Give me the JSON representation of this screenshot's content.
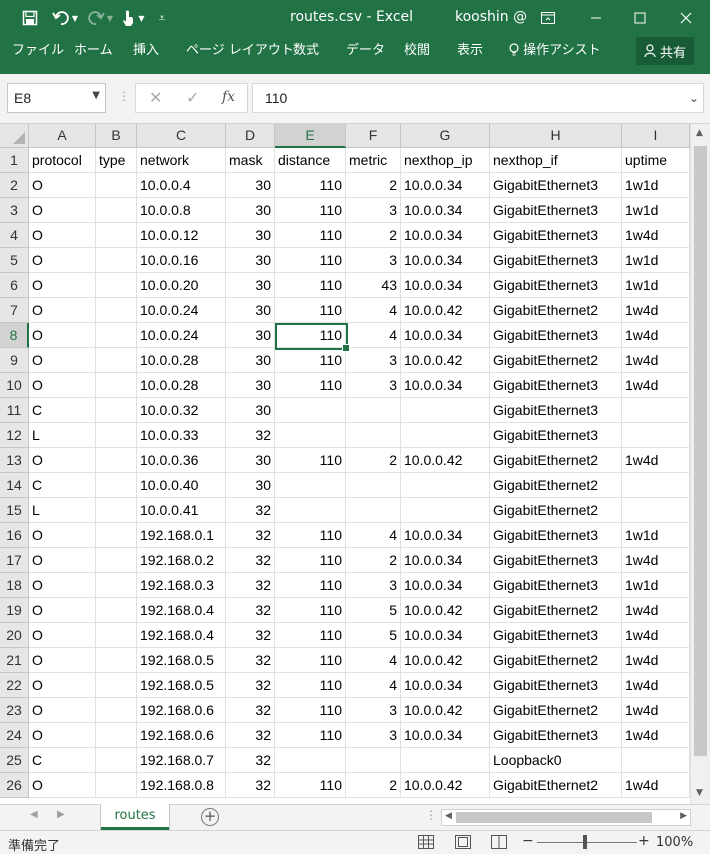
{
  "window": {
    "doc_title": "routes.csv  -  Excel",
    "user": "kooshin @",
    "share_label": "共有"
  },
  "ribbon": {
    "tabs": [
      "ファイル",
      "ホーム",
      "挿入",
      "ページ レイアウト",
      "数式",
      "データ",
      "校閲",
      "表示",
      "操作アシスト"
    ]
  },
  "formula_bar": {
    "name_box": "E8",
    "content": "110"
  },
  "columns": [
    "A",
    "B",
    "C",
    "D",
    "E",
    "F",
    "G",
    "H",
    "I"
  ],
  "selected_column": "E",
  "selected_row": 8,
  "rows": [
    {
      "n": 1,
      "cells": [
        "protocol",
        "type",
        "network",
        "mask",
        "distance",
        "metric",
        "nexthop_ip",
        "nexthop_if",
        "uptime"
      ]
    },
    {
      "n": 2,
      "cells": [
        "O",
        "",
        "10.0.0.4",
        "30",
        "110",
        "2",
        "10.0.0.34",
        "GigabitEthernet3",
        "1w1d"
      ]
    },
    {
      "n": 3,
      "cells": [
        "O",
        "",
        "10.0.0.8",
        "30",
        "110",
        "3",
        "10.0.0.34",
        "GigabitEthernet3",
        "1w1d"
      ]
    },
    {
      "n": 4,
      "cells": [
        "O",
        "",
        "10.0.0.12",
        "30",
        "110",
        "2",
        "10.0.0.34",
        "GigabitEthernet3",
        "1w4d"
      ]
    },
    {
      "n": 5,
      "cells": [
        "O",
        "",
        "10.0.0.16",
        "30",
        "110",
        "3",
        "10.0.0.34",
        "GigabitEthernet3",
        "1w1d"
      ]
    },
    {
      "n": 6,
      "cells": [
        "O",
        "",
        "10.0.0.20",
        "30",
        "110",
        "43",
        "10.0.0.34",
        "GigabitEthernet3",
        "1w1d"
      ]
    },
    {
      "n": 7,
      "cells": [
        "O",
        "",
        "10.0.0.24",
        "30",
        "110",
        "4",
        "10.0.0.42",
        "GigabitEthernet2",
        "1w4d"
      ]
    },
    {
      "n": 8,
      "cells": [
        "O",
        "",
        "10.0.0.24",
        "30",
        "110",
        "4",
        "10.0.0.34",
        "GigabitEthernet3",
        "1w4d"
      ]
    },
    {
      "n": 9,
      "cells": [
        "O",
        "",
        "10.0.0.28",
        "30",
        "110",
        "3",
        "10.0.0.42",
        "GigabitEthernet2",
        "1w4d"
      ]
    },
    {
      "n": 10,
      "cells": [
        "O",
        "",
        "10.0.0.28",
        "30",
        "110",
        "3",
        "10.0.0.34",
        "GigabitEthernet3",
        "1w4d"
      ]
    },
    {
      "n": 11,
      "cells": [
        "C",
        "",
        "10.0.0.32",
        "30",
        "",
        "",
        "",
        "GigabitEthernet3",
        ""
      ]
    },
    {
      "n": 12,
      "cells": [
        "L",
        "",
        "10.0.0.33",
        "32",
        "",
        "",
        "",
        "GigabitEthernet3",
        ""
      ]
    },
    {
      "n": 13,
      "cells": [
        "O",
        "",
        "10.0.0.36",
        "30",
        "110",
        "2",
        "10.0.0.42",
        "GigabitEthernet2",
        "1w4d"
      ]
    },
    {
      "n": 14,
      "cells": [
        "C",
        "",
        "10.0.0.40",
        "30",
        "",
        "",
        "",
        "GigabitEthernet2",
        ""
      ]
    },
    {
      "n": 15,
      "cells": [
        "L",
        "",
        "10.0.0.41",
        "32",
        "",
        "",
        "",
        "GigabitEthernet2",
        ""
      ]
    },
    {
      "n": 16,
      "cells": [
        "O",
        "",
        "192.168.0.1",
        "32",
        "110",
        "4",
        "10.0.0.34",
        "GigabitEthernet3",
        "1w1d"
      ]
    },
    {
      "n": 17,
      "cells": [
        "O",
        "",
        "192.168.0.2",
        "32",
        "110",
        "2",
        "10.0.0.34",
        "GigabitEthernet3",
        "1w4d"
      ]
    },
    {
      "n": 18,
      "cells": [
        "O",
        "",
        "192.168.0.3",
        "32",
        "110",
        "3",
        "10.0.0.34",
        "GigabitEthernet3",
        "1w1d"
      ]
    },
    {
      "n": 19,
      "cells": [
        "O",
        "",
        "192.168.0.4",
        "32",
        "110",
        "5",
        "10.0.0.42",
        "GigabitEthernet2",
        "1w4d"
      ]
    },
    {
      "n": 20,
      "cells": [
        "O",
        "",
        "192.168.0.4",
        "32",
        "110",
        "5",
        "10.0.0.34",
        "GigabitEthernet3",
        "1w4d"
      ]
    },
    {
      "n": 21,
      "cells": [
        "O",
        "",
        "192.168.0.5",
        "32",
        "110",
        "4",
        "10.0.0.42",
        "GigabitEthernet2",
        "1w4d"
      ]
    },
    {
      "n": 22,
      "cells": [
        "O",
        "",
        "192.168.0.5",
        "32",
        "110",
        "4",
        "10.0.0.34",
        "GigabitEthernet3",
        "1w4d"
      ]
    },
    {
      "n": 23,
      "cells": [
        "O",
        "",
        "192.168.0.6",
        "32",
        "110",
        "3",
        "10.0.0.42",
        "GigabitEthernet2",
        "1w4d"
      ]
    },
    {
      "n": 24,
      "cells": [
        "O",
        "",
        "192.168.0.6",
        "32",
        "110",
        "3",
        "10.0.0.34",
        "GigabitEthernet3",
        "1w4d"
      ]
    },
    {
      "n": 25,
      "cells": [
        "C",
        "",
        "192.168.0.7",
        "32",
        "",
        "",
        "",
        "Loopback0",
        ""
      ]
    },
    {
      "n": 26,
      "cells": [
        "O",
        "",
        "192.168.0.8",
        "32",
        "110",
        "2",
        "10.0.0.42",
        "GigabitEthernet2",
        "1w4d"
      ]
    }
  ],
  "sheet_tabs": [
    "routes"
  ],
  "status": {
    "text": "準備完了",
    "zoom": "100%",
    "zoom_level": 1.0
  },
  "colors": {
    "accent": "#217346",
    "header_bg": "#e6e6e6",
    "gridline": "#e1e1e1"
  }
}
